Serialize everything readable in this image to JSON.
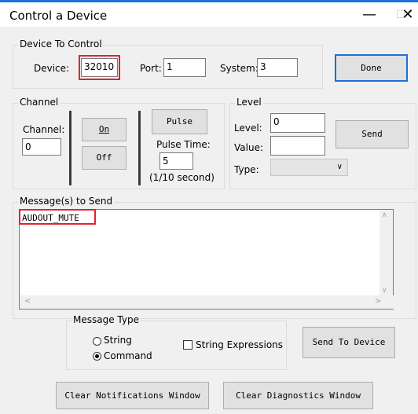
{
  "window": {
    "title": "Control a Device",
    "minimize_glyph": "—",
    "maximize_glyph": "☐",
    "close_glyph": "✕"
  },
  "device_group": {
    "title": "Device To Control",
    "device_label": "Device:",
    "device_value": "32010",
    "port_label": "Port:",
    "port_value": "1",
    "system_label": "System:",
    "system_value": "3",
    "done_label": "Done"
  },
  "channel_group": {
    "title": "Channel",
    "channel_label": "Channel:",
    "channel_value": "0",
    "on_label": "On",
    "off_label": "Off",
    "pulse_label": "Pulse",
    "pulse_time_label": "Pulse Time:",
    "pulse_time_value": "5",
    "pulse_unit": "(1/10 second)"
  },
  "level_group": {
    "title": "Level",
    "level_label": "Level:",
    "level_value": "0",
    "value_label": "Value:",
    "value_value": "",
    "type_label": "Type:",
    "type_value": "",
    "send_label": "Send"
  },
  "message_group": {
    "title": "Message(s) to Send",
    "message_text": "AUDOUT_MUTE"
  },
  "message_type": {
    "title": "Message Type",
    "option_string": "String",
    "option_command": "Command",
    "selected": "Command",
    "string_expressions_label": "String Expressions",
    "string_expressions_checked": false,
    "send_to_device_label": "Send To Device"
  },
  "footer": {
    "clear_notifications_label": "Clear Notifications Window",
    "clear_diagnostics_label": "Clear Diagnostics Window"
  },
  "icons": {
    "scroll_up": "∧",
    "scroll_down": "∨",
    "scroll_left": "<",
    "scroll_right": ">",
    "dropdown": "∨"
  },
  "colors": {
    "highlight": "#e0242b",
    "accent_top": "#1e6fd9",
    "done_border": "#1e6fd9"
  }
}
